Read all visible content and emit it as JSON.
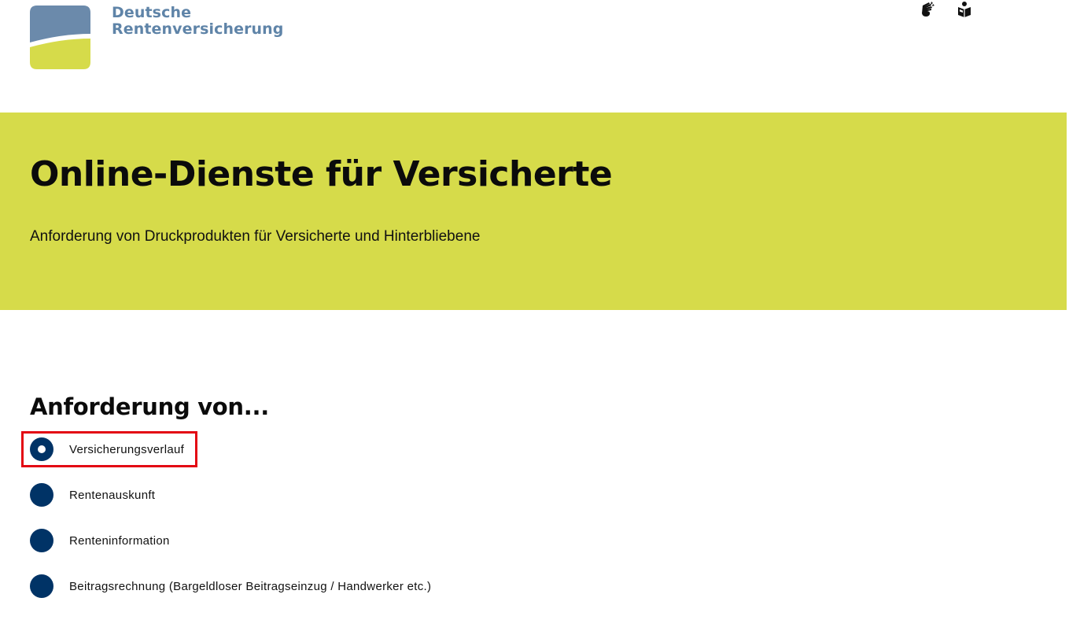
{
  "header": {
    "brand_line1": "Deutsche",
    "brand_line2": "Rentenversicherung",
    "icons": [
      "sign-language-icon",
      "easy-language-icon"
    ]
  },
  "hero": {
    "title": "Online-Dienste für Versicherte",
    "subtitle": "Anforderung von Druckprodukten für Versicherte und Hinterbliebene"
  },
  "form": {
    "section_title": "Anforderung von...",
    "options": [
      {
        "label": "Versicherungsverlauf",
        "checked": true
      },
      {
        "label": "Rentenauskunft",
        "checked": false
      },
      {
        "label": "Renteninformation",
        "checked": false
      },
      {
        "label": "Beitragsrechnung (Bargeldloser Beitragseinzug / Handwerker etc.)",
        "checked": false
      }
    ]
  },
  "colors": {
    "brand_blue": "#5f84a8",
    "brand_green": "#d6db4a",
    "radio": "#003366",
    "highlight": "#e30613"
  }
}
